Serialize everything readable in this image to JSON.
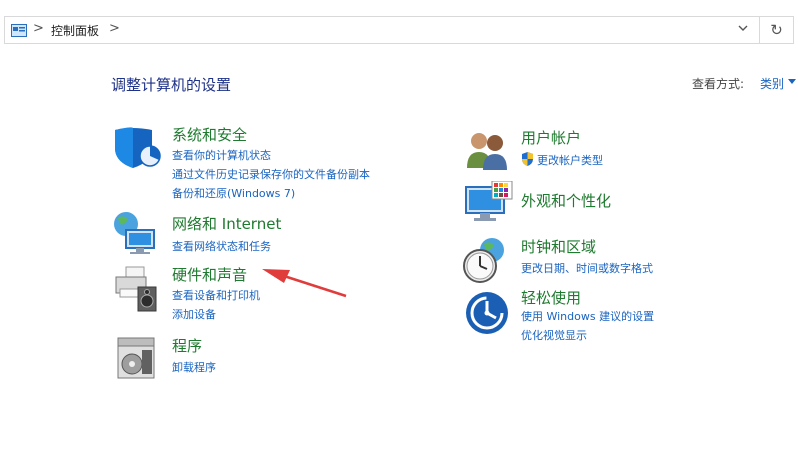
{
  "address": {
    "breadcrumb": "控制面板",
    "separators": [
      ">",
      ">"
    ],
    "dropdown_glyph": "⌄",
    "refresh_glyph": "↻"
  },
  "header": {
    "title": "调整计算机的设置",
    "view_by_label": "查看方式:",
    "view_by_value": "类别"
  },
  "categories": {
    "system": {
      "title": "系统和安全",
      "links": [
        "查看你的计算机状态",
        "通过文件历史记录保存你的文件备份副本",
        "备份和还原(Windows 7)"
      ]
    },
    "network": {
      "title": "网络和 Internet",
      "links": [
        "查看网络状态和任务"
      ]
    },
    "hardware": {
      "title": "硬件和声音",
      "links": [
        "查看设备和打印机",
        "添加设备"
      ]
    },
    "programs": {
      "title": "程序",
      "links": [
        "卸载程序"
      ]
    },
    "users": {
      "title": "用户帐户",
      "links": [
        "更改帐户类型"
      ]
    },
    "appearance": {
      "title": "外观和个性化",
      "links": []
    },
    "clock": {
      "title": "时钟和区域",
      "links": [
        "更改日期、时间或数字格式"
      ]
    },
    "ease": {
      "title": "轻松使用",
      "links": [
        "使用 Windows 建议的设置",
        "优化视觉显示"
      ]
    }
  },
  "colors": {
    "title_green": "#1e7a2e",
    "link_blue": "#1a64c0",
    "heading_blue": "#1e3287",
    "arrow_red": "#e03c3c"
  }
}
